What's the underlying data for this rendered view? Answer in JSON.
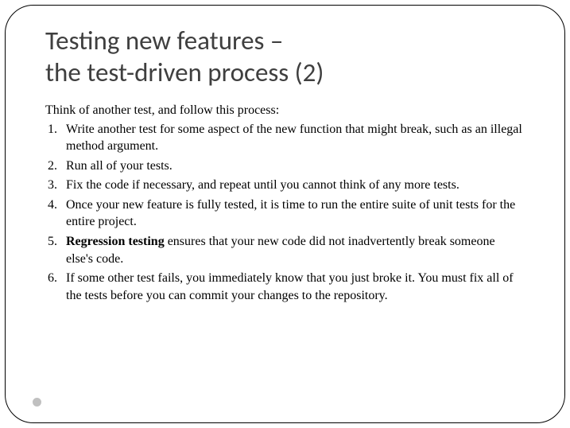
{
  "title_line1": "Testing new features –",
  "title_line2": "the test-driven process (2)",
  "intro": "Think of another test, and follow this process:",
  "items": [
    {
      "text": "Write another test for some aspect of the new function that might break, such as an illegal method argument."
    },
    {
      "text": "Run all of your tests."
    },
    {
      "text": "Fix the code if necessary, and repeat until you cannot think of any more tests."
    },
    {
      "text": "Once your new feature is fully tested, it is time to run the entire suite of unit tests for the entire project."
    },
    {
      "bold_prefix": "Regression testing",
      "rest": " ensures that your new code did not inadvertently break someone else's code."
    },
    {
      "text": "If some other test fails, you immediately know that you just broke it. You must fix all of the tests before you can commit your changes to the repository."
    }
  ]
}
